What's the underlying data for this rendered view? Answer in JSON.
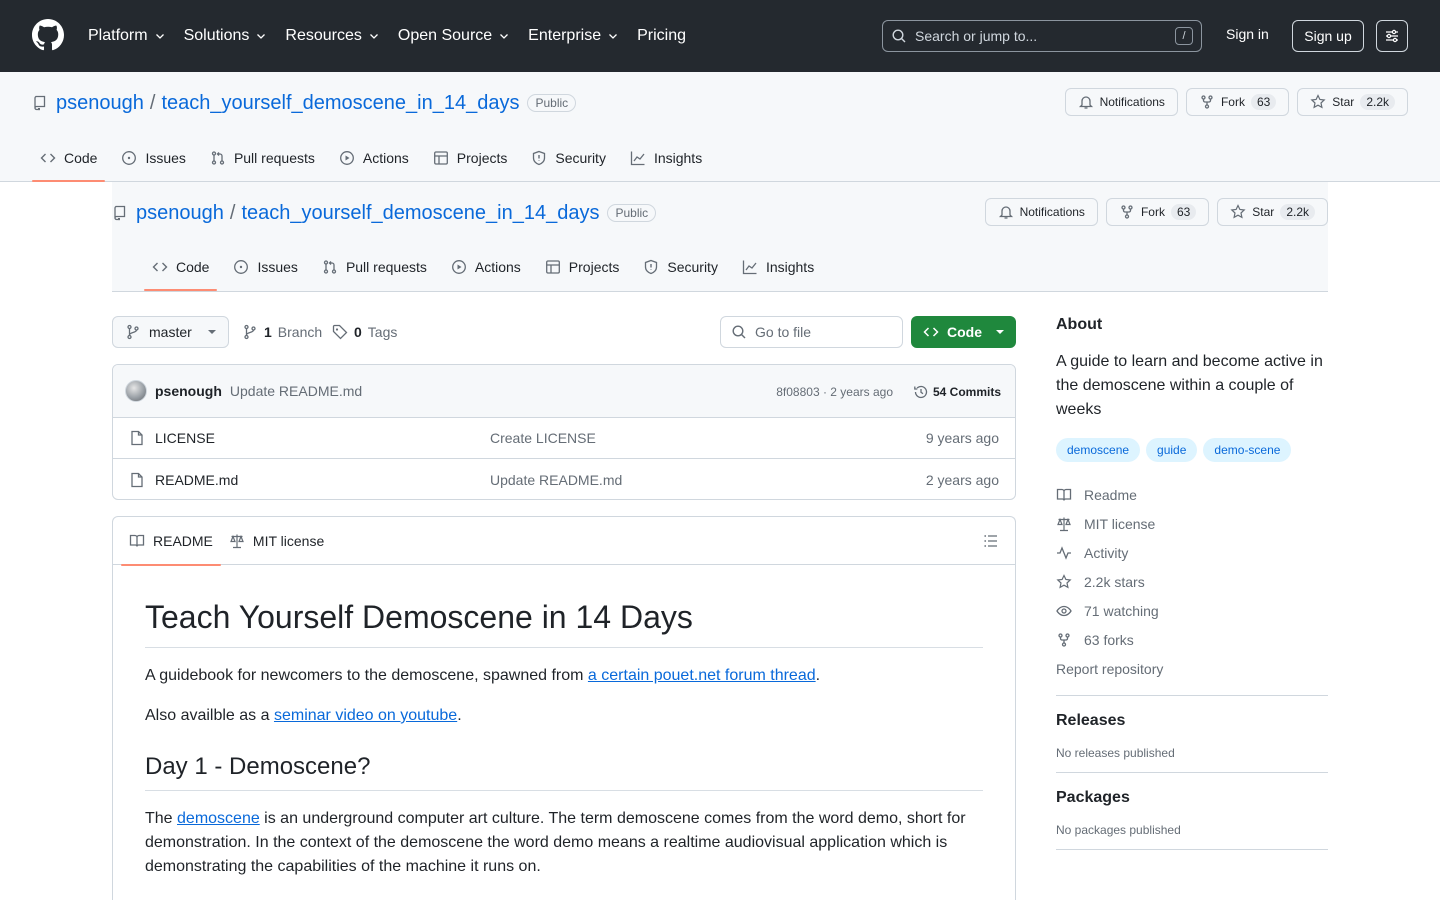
{
  "header": {
    "nav": [
      "Platform",
      "Solutions",
      "Resources",
      "Open Source",
      "Enterprise",
      "Pricing"
    ],
    "search_placeholder": "Search or jump to...",
    "search_shortcut": "/",
    "sign_in": "Sign in",
    "sign_up": "Sign up"
  },
  "repo": {
    "owner": "psenough",
    "separator": "/",
    "name": "teach_yourself_demoscene_in_14_days",
    "visibility": "Public",
    "notifications_label": "Notifications",
    "fork_label": "Fork",
    "fork_count": "63",
    "star_label": "Star",
    "star_count": "2.2k",
    "tabs": [
      "Code",
      "Issues",
      "Pull requests",
      "Actions",
      "Projects",
      "Security",
      "Insights"
    ]
  },
  "toolbar": {
    "branch": "master",
    "branch_count": "1",
    "branch_label": "Branch",
    "tag_count": "0",
    "tag_label": "Tags",
    "goto_placeholder": "Go to file",
    "code_label": "Code"
  },
  "commit": {
    "author": "psenough",
    "message": "Update README.md",
    "hash_time": "8f08803 · 2 years ago",
    "commits_label": "54 Commits"
  },
  "files": [
    {
      "name": "LICENSE",
      "message": "Create LICENSE",
      "date": "9 years ago"
    },
    {
      "name": "README.md",
      "message": "Update README.md",
      "date": "2 years ago"
    }
  ],
  "readme": {
    "tab_readme": "README",
    "tab_license": "MIT license",
    "title": "Teach Yourself Demoscene in 14 Days",
    "p1_pre": "A guidebook for newcomers to the demoscene, spawned from ",
    "p1_link": "a certain pouet.net forum thread",
    "p1_post": ".",
    "p2_pre": "Also availble as a ",
    "p2_link": "seminar video on youtube",
    "p2_post": ".",
    "h2": "Day 1 - Demoscene?",
    "p3_pre": "The ",
    "p3_link": "demoscene",
    "p3_post": " is an underground computer art culture. The term demoscene comes from the word demo, short for demonstration. In the context of the demoscene the word demo means a realtime audiovisual application which is demonstrating the capabilities of the machine it runs on."
  },
  "sidebar": {
    "about_title": "About",
    "about_text": "A guide to learn and become active in the demoscene within a couple of weeks",
    "topics": [
      "demoscene",
      "guide",
      "demo-scene"
    ],
    "items": [
      "Readme",
      "MIT license",
      "Activity",
      "2.2k stars",
      "71 watching",
      "63 forks"
    ],
    "report": "Report repository",
    "releases_title": "Releases",
    "releases_text": "No releases published",
    "packages_title": "Packages",
    "packages_text": "No packages published"
  },
  "colors": {
    "header_bg": "#24292f",
    "link": "#0969da",
    "primary_button": "#1f883d",
    "tab_underline": "#fd8c73"
  }
}
